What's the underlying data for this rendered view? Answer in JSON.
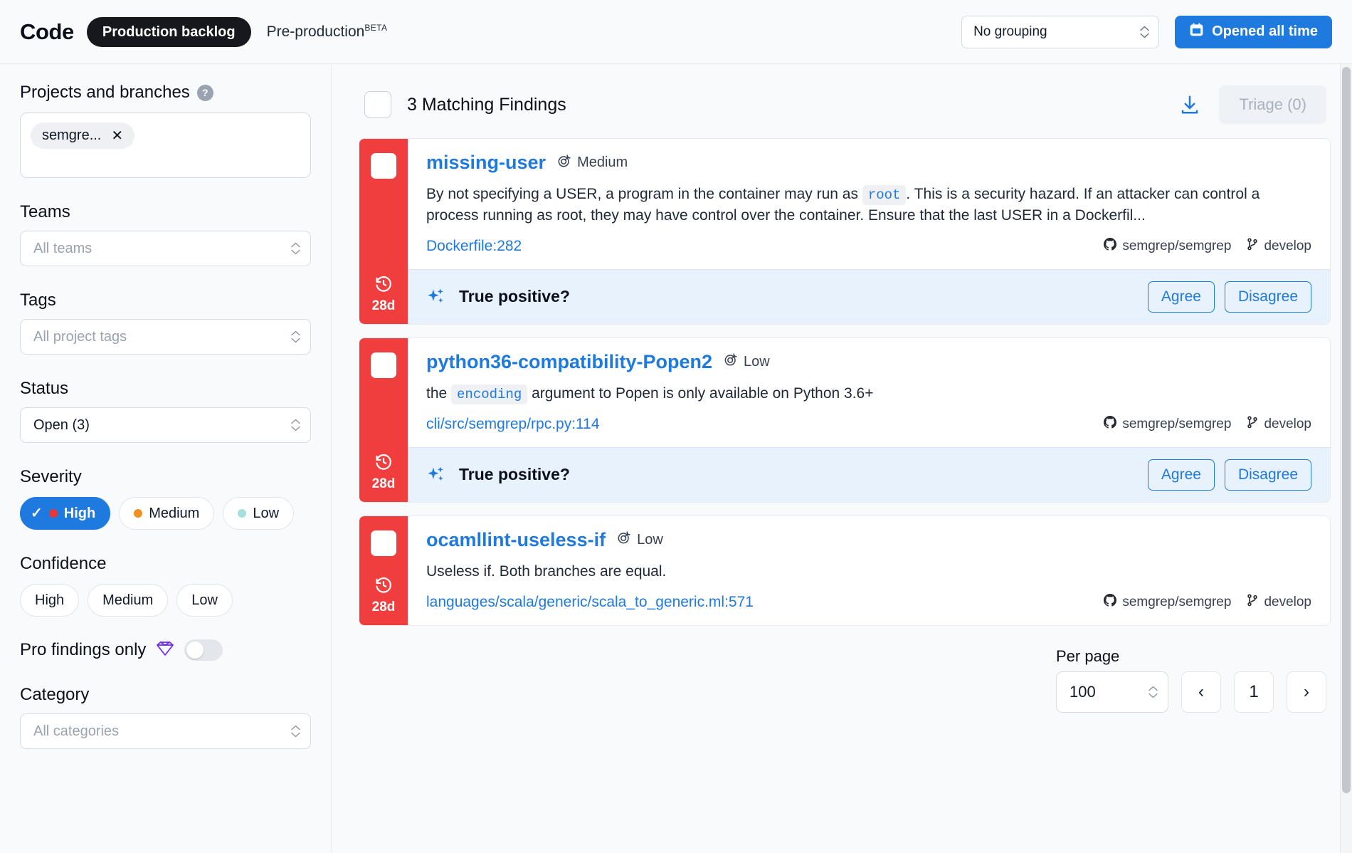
{
  "header": {
    "brand": "Code",
    "active_pill": "Production backlog",
    "preproduction_label": "Pre-production",
    "beta_label": "BETA",
    "grouping_value": "No grouping",
    "date_button": "Opened all time"
  },
  "sidebar": {
    "projects": {
      "title": "Projects and branches",
      "help": "?",
      "chips": [
        {
          "label": "semgre...",
          "remove": "✕"
        }
      ]
    },
    "teams": {
      "label": "Teams",
      "placeholder": "All teams"
    },
    "tags": {
      "label": "Tags",
      "placeholder": "All project tags"
    },
    "status": {
      "label": "Status",
      "value": "Open (3)"
    },
    "severity": {
      "label": "Severity",
      "options": [
        {
          "label": "High",
          "color": "#e5383b",
          "active": true,
          "check": "✓"
        },
        {
          "label": "Medium",
          "color": "#ef9020",
          "active": false
        },
        {
          "label": "Low",
          "color": "#a5dfe0",
          "active": false
        }
      ]
    },
    "confidence": {
      "label": "Confidence",
      "options": [
        {
          "label": "High"
        },
        {
          "label": "Medium"
        },
        {
          "label": "Low"
        }
      ]
    },
    "pro": {
      "label": "Pro findings only",
      "icon": "gem-icon",
      "enabled": false
    },
    "category": {
      "label": "Category",
      "placeholder": "All categories"
    }
  },
  "main": {
    "count_label": "3 Matching Findings",
    "download_icon": "download-icon",
    "triage_label": "Triage (0)",
    "findings": [
      {
        "rule": "missing-user",
        "severity_text": "Medium",
        "age": "28d",
        "stripe_color": "#f03e3e",
        "desc_prefix": "By not specifying a USER, a program in the container may run as ",
        "code": "root",
        "desc_suffix": ". This is a security hazard. If an attacker can control a process running as root, they may have control over the container. Ensure that the last USER in a Dockerfil...",
        "location": "Dockerfile:282",
        "repo": "semgrep/semgrep",
        "branch": "develop",
        "ai": {
          "question": "True positive?",
          "agree": "Agree",
          "disagree": "Disagree"
        }
      },
      {
        "rule": "python36-compatibility-Popen2",
        "severity_text": "Low",
        "age": "28d",
        "stripe_color": "#f03e3e",
        "desc_prefix": "the ",
        "code": "encoding",
        "desc_suffix": " argument to Popen is only available on Python 3.6+",
        "location": "cli/src/semgrep/rpc.py:114",
        "repo": "semgrep/semgrep",
        "branch": "develop",
        "ai": {
          "question": "True positive?",
          "agree": "Agree",
          "disagree": "Disagree"
        }
      },
      {
        "rule": "ocamllint-useless-if",
        "severity_text": "Low",
        "age": "28d",
        "stripe_color": "#f03e3e",
        "desc_prefix": "Useless if. Both branches are equal.",
        "code": "",
        "desc_suffix": "",
        "location": "languages/scala/generic/scala_to_generic.ml:571",
        "repo": "semgrep/semgrep",
        "branch": "develop",
        "ai": null
      }
    ],
    "pagination": {
      "per_page_label": "Per page",
      "per_page_value": "100",
      "prev": "‹",
      "page": "1",
      "next": "›"
    }
  },
  "colors": {
    "accent_blue": "#1f7ae0",
    "severity_high": "#f03e3e",
    "ai_bar_bg": "#e8f2fd",
    "pro_purple": "#6d28f0"
  }
}
